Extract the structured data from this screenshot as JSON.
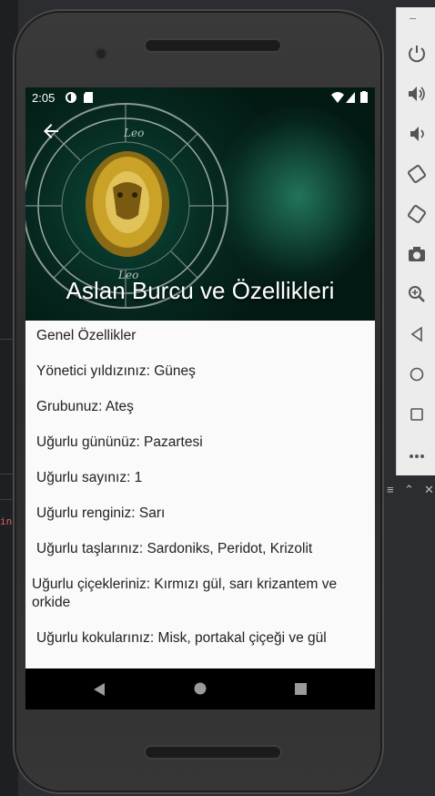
{
  "status": {
    "time": "2:05"
  },
  "header": {
    "title": "Aslan Burcu ve Özellikleri"
  },
  "items": [
    "Genel Özellikler",
    "Yönetici yıldızınız: Güneş",
    "Grubunuz: Ateş",
    "Uğurlu gününüz: Pazartesi",
    "Uğurlu sayınız: 1",
    "Uğurlu renginiz: Sarı",
    "Uğurlu taşlarınız: Sardoniks, Peridot, Krizolit",
    " Uğurlu çiçekleriniz: Kırmızı gül, sarı krizantem ve orkide",
    "Uğurlu kokularınız: Misk, portakal çiçeği ve gül"
  ],
  "wheel": {
    "top_label": "Leo",
    "bottom_label": "Leo"
  },
  "ide": {
    "error_fragment": "in"
  },
  "emulator_toolbar": [
    "power-icon",
    "volume-up-icon",
    "volume-down-icon",
    "rotate-left-icon",
    "rotate-right-icon",
    "camera-icon",
    "zoom-icon",
    "back-icon",
    "home-icon",
    "overview-icon",
    "more-icon"
  ],
  "colors": {
    "accent": "#0e5a42",
    "gold": "#c9a227"
  }
}
